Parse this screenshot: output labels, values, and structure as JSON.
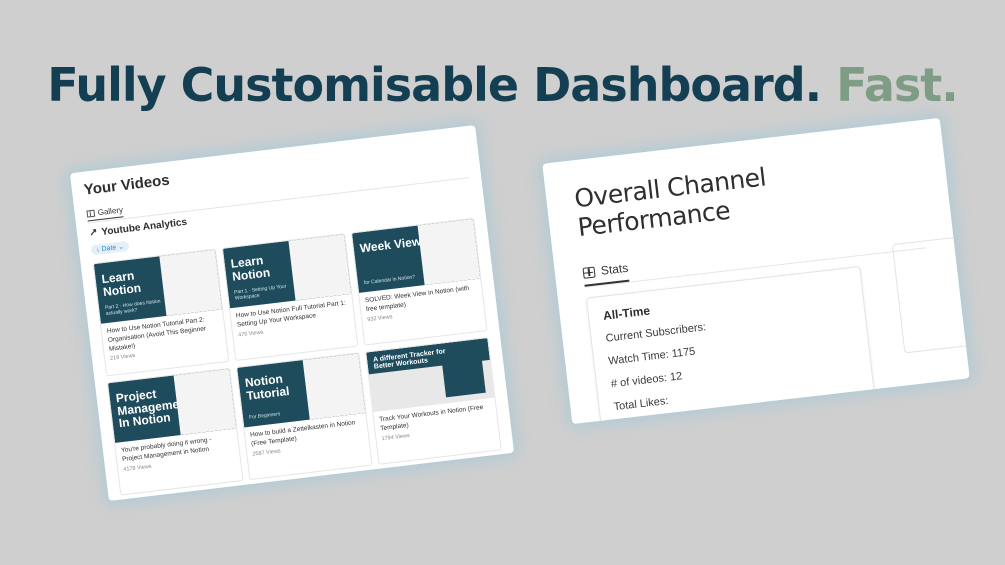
{
  "headline": {
    "main": "Fully Customisable Dashboard.",
    "accent": "Fast."
  },
  "videos_panel": {
    "title": "Your Videos",
    "tab": "Gallery",
    "section": "Youtube Analytics",
    "filter": "Date",
    "cards": [
      {
        "thumb_text": "Learn Notion",
        "thumb_sub": "Part 2 · How does Notion actually work?",
        "title": "How to Use Notion Tutorial Part 2: Organisation (Avoid This Beginner Mistake!)",
        "views": "219 Views"
      },
      {
        "thumb_text": "Learn Notion",
        "thumb_sub": "Part 1 · Setting Up Your Workspace",
        "title": "How to Use Notion Full Tutorial Part 1: Setting Up Your Workspace",
        "views": "476 Views"
      },
      {
        "thumb_text": "Week View",
        "thumb_sub": "for Calendar in Notion?",
        "title": "SOLVED: Week View in Notion (with free template)",
        "views": "932 Views"
      },
      {
        "thumb_text": "Project Management In Notion",
        "thumb_sub": "",
        "title": "You're probably doing it wrong - Project Management in Notion",
        "views": "4178 Views"
      },
      {
        "thumb_text": "Notion Tutorial",
        "thumb_sub": "For Beginners",
        "title": "How to build a Zettelkasten in Notion (Free Template)",
        "views": "2587 Views"
      },
      {
        "thumb_text": "A different Tracker for Better Workouts",
        "thumb_sub": "",
        "title": "Track Your Workouts in Notion (Free Template)",
        "views": "1794 Views"
      }
    ]
  },
  "performance_panel": {
    "title": "Overall Channel Performance",
    "tab": "Stats",
    "card": {
      "title": "All-Time",
      "rows": [
        "Current Subscribers:",
        "Watch Time: 1175",
        "# of videos: 12",
        "Total Likes:"
      ]
    }
  }
}
